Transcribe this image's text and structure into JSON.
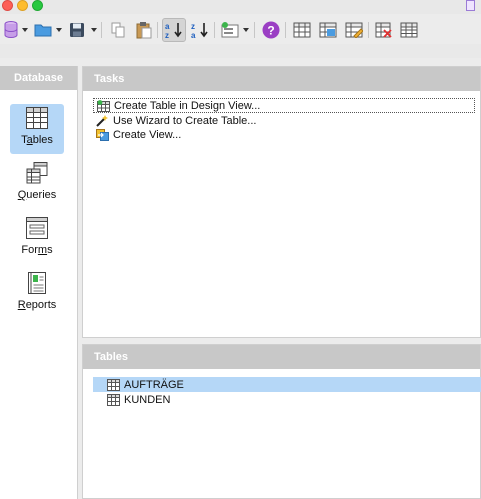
{
  "window": {
    "colors": {
      "close": "#fd5f57",
      "minimize": "#febc2e",
      "zoom": "#28c840"
    }
  },
  "toolbar": {
    "buttons": [
      {
        "icon": "database-icon"
      },
      {
        "icon": "open-folder-icon"
      },
      {
        "icon": "save-icon"
      },
      {
        "icon": "copy-icon"
      },
      {
        "icon": "paste-icon"
      },
      {
        "icon": "sort-ascending-icon"
      },
      {
        "icon": "sort-descending-icon"
      },
      {
        "icon": "form-wizard-icon"
      },
      {
        "icon": "help-icon"
      },
      {
        "icon": "new-table-icon"
      },
      {
        "icon": "table-view-icon"
      },
      {
        "icon": "edit-table-icon"
      },
      {
        "icon": "delete-table-icon"
      },
      {
        "icon": "table-properties-icon"
      }
    ]
  },
  "sidebar": {
    "title": "Database",
    "items": [
      {
        "label": "Tables",
        "icon": "tables-icon",
        "active": true
      },
      {
        "label": "Queries",
        "icon": "queries-icon",
        "active": false
      },
      {
        "label": "Forms",
        "icon": "forms-icon",
        "active": false
      },
      {
        "label": "Reports",
        "icon": "reports-icon",
        "active": false
      }
    ]
  },
  "tasks": {
    "title": "Tasks",
    "items": [
      {
        "label": "Create Table in Design View...",
        "icon": "design-view-icon"
      },
      {
        "label": "Use Wizard to Create Table...",
        "icon": "wizard-wand-icon"
      },
      {
        "label": "Create View...",
        "icon": "create-view-icon"
      }
    ]
  },
  "tables": {
    "title": "Tables",
    "items": [
      {
        "label": "AUFTRÄGE",
        "selected": true
      },
      {
        "label": "KUNDEN",
        "selected": false
      }
    ]
  },
  "accent": "#b5d7f7"
}
